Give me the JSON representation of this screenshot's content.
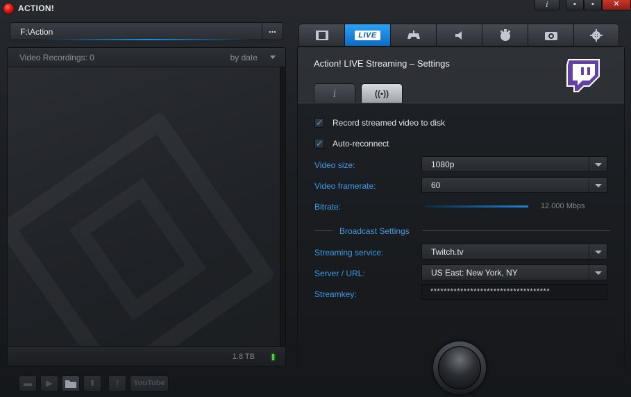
{
  "window": {
    "title": "ACTION!",
    "info_label": "i",
    "minimize_label": "▪",
    "maximize_label": "▪",
    "close_label": "✕"
  },
  "left": {
    "path": "F:\\Action",
    "browse_label": "...",
    "recordings_label": "Video Recordings: 0",
    "sort_label": "by date",
    "disk_space": "1.8 TB"
  },
  "bottom_toolbar": {
    "youtube_label": "YouTube",
    "facebook_label": "f"
  },
  "tabs": {
    "items": [
      {
        "name": "video-tab",
        "icon": "film-icon"
      },
      {
        "name": "live-tab",
        "label": "LIVE",
        "active": true
      },
      {
        "name": "game-tab",
        "icon": "controller-icon"
      },
      {
        "name": "audio-tab",
        "icon": "speaker-icon"
      },
      {
        "name": "timer-tab",
        "icon": "stopwatch-icon"
      },
      {
        "name": "screenshot-tab",
        "icon": "camera-icon"
      },
      {
        "name": "settings-tab",
        "icon": "gear-icon"
      }
    ]
  },
  "settings": {
    "title": "Action! LIVE Streaming – Settings",
    "info_tab_label": "i",
    "broadcast_tab_label": "((•))",
    "record_to_disk": {
      "label": "Record streamed video to disk",
      "checked": true
    },
    "auto_reconnect": {
      "label": "Auto-reconnect",
      "checked": true
    },
    "video_size": {
      "label": "Video size:",
      "value": "1080p"
    },
    "video_framerate": {
      "label": "Video framerate:",
      "value": "60"
    },
    "bitrate": {
      "label": "Bitrate:",
      "value": "12.000 Mbps"
    },
    "broadcast_section": "Broadcast Settings",
    "streaming_service": {
      "label": "Streaming service:",
      "value": "Twitch.tv"
    },
    "server": {
      "label": "Server / URL:",
      "value": "US East: New York, NY"
    },
    "streamkey": {
      "label": "Streamkey:",
      "value": "************************************"
    }
  },
  "colors": {
    "accent": "#1f8fe6",
    "label_blue": "#3d9be6",
    "twitch_purple": "#6441a5",
    "record_led": "#49d43a"
  }
}
